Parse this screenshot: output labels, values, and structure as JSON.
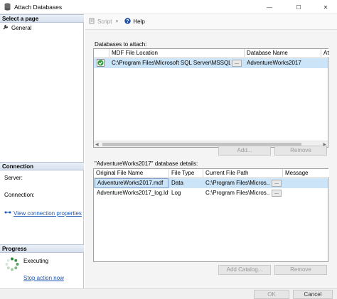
{
  "window": {
    "title": "Attach Databases",
    "controls": {
      "minimize": "—",
      "maximize": "☐",
      "close": "✕"
    }
  },
  "left": {
    "select_page_header": "Select a page",
    "pages": [
      {
        "label": "General",
        "icon": "wrench-icon"
      }
    ],
    "connection_header": "Connection",
    "server_label": "Server:",
    "server_value": "",
    "connection_label": "Connection:",
    "connection_value": "",
    "view_connection_properties": "View connection properties",
    "progress_header": "Progress",
    "progress_status": "Executing",
    "stop_action": "Stop action now"
  },
  "toolbar": {
    "script_label": "Script",
    "help_label": "Help"
  },
  "databases_to_attach": {
    "label": "Databases to attach:",
    "columns": [
      "",
      "MDF File Location",
      "Database Name",
      "Att"
    ],
    "rows": [
      {
        "status": "ok",
        "mdf_location": "C:\\Program Files\\Microsoft SQL Server\\MSSQL...",
        "browse": "...",
        "database_name": "AdventureWorks2017"
      }
    ],
    "add_button": "Add...",
    "remove_button": "Remove"
  },
  "details": {
    "label": "\"AdventureWorks2017\" database details:",
    "columns": [
      "Original File Name",
      "File Type",
      "Current File Path",
      "Message"
    ],
    "rows": [
      {
        "original": "AdventureWorks2017.mdf",
        "type": "Data",
        "path": "C:\\Program Files\\Micros...",
        "browse": "...",
        "message": ""
      },
      {
        "original": "AdventureWorks2017_log.ldf",
        "type": "Log",
        "path": "C:\\Program Files\\Micros...",
        "browse": "...",
        "message": ""
      }
    ],
    "add_catalog_button": "Add Catalog...",
    "remove_button": "Remove"
  },
  "footer": {
    "ok_button": "OK",
    "cancel_button": "Cancel"
  }
}
